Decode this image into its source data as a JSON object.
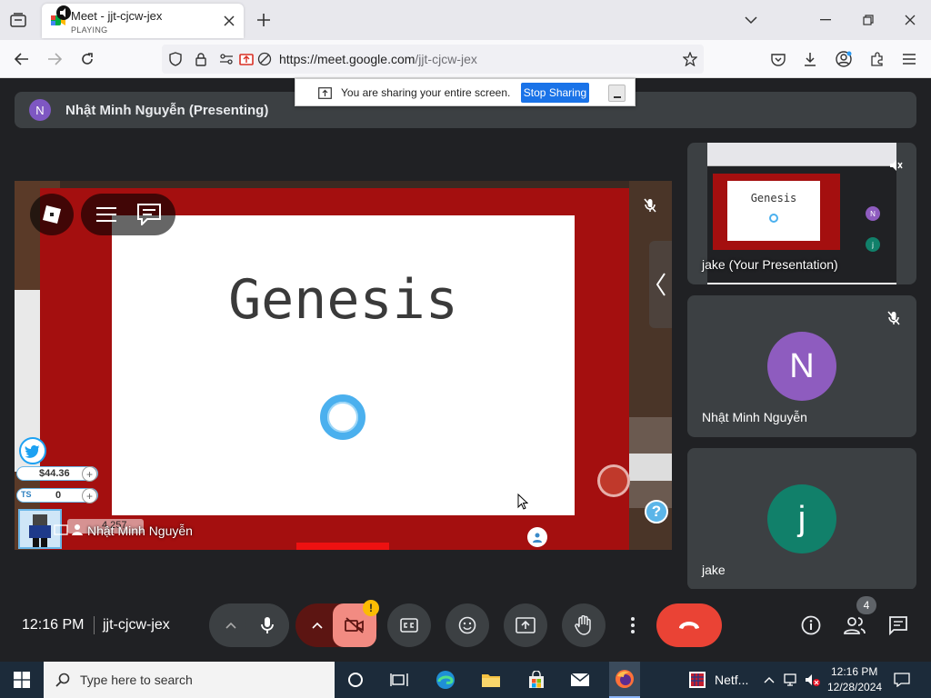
{
  "browser": {
    "tab_title": "Meet - jjt-cjcw-jex",
    "tab_subtitle": "PLAYING",
    "url_host": "https://meet.google.com",
    "url_path": "/jjt-cjcw-jex"
  },
  "share_banner": {
    "message": "You are sharing your entire screen.",
    "stop_label": "Stop Sharing"
  },
  "presenter": {
    "initial": "N",
    "label": "Nhật Minh Nguyễn (Presenting)"
  },
  "stage": {
    "slide_title": "Genesis",
    "balance": "$44.36",
    "ts_label": "TS",
    "ts_value": "0",
    "score": "4,257",
    "name_overlay": "Nhật Minh Nguyễn",
    "help": "?"
  },
  "tiles": [
    {
      "name": "jake (Your Presentation)",
      "thumb_title": "Genesis"
    },
    {
      "name": "Nhật Minh Nguyễn",
      "initial": "N",
      "color": "#8e5cbf"
    },
    {
      "name": "jake",
      "initial": "j",
      "color": "#11806a"
    }
  ],
  "meeting": {
    "time": "12:16 PM",
    "code": "jjt-cjcw-jex",
    "people_count": "4",
    "warning_badge": "!"
  },
  "taskbar": {
    "search_placeholder": "Type here to search",
    "netflix_label": "Netf...",
    "clock_time": "12:16 PM",
    "clock_date": "12/28/2024"
  },
  "colors": {
    "accent_blue": "#1a73e8",
    "end_call_red": "#ea4335",
    "camera_off": "#f28b82"
  }
}
